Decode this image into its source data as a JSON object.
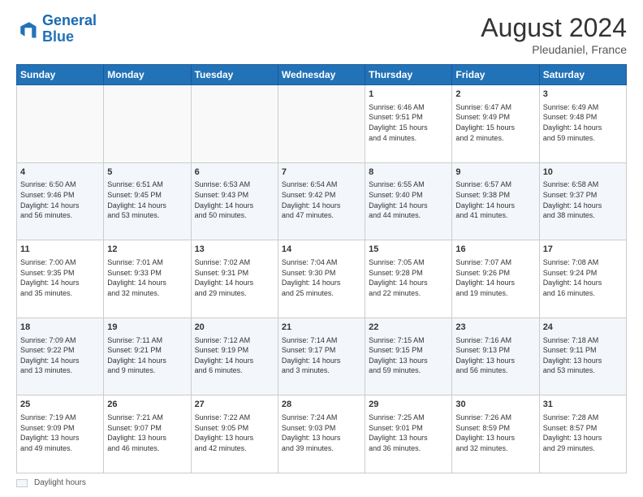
{
  "header": {
    "logo_general": "General",
    "logo_blue": "Blue",
    "month_year": "August 2024",
    "location": "Pleudaniel, France"
  },
  "footer": {
    "label": "Daylight hours"
  },
  "days_of_week": [
    "Sunday",
    "Monday",
    "Tuesday",
    "Wednesday",
    "Thursday",
    "Friday",
    "Saturday"
  ],
  "weeks": [
    {
      "days": [
        {
          "num": "",
          "info": ""
        },
        {
          "num": "",
          "info": ""
        },
        {
          "num": "",
          "info": ""
        },
        {
          "num": "",
          "info": ""
        },
        {
          "num": "1",
          "info": "Sunrise: 6:46 AM\nSunset: 9:51 PM\nDaylight: 15 hours\nand 4 minutes."
        },
        {
          "num": "2",
          "info": "Sunrise: 6:47 AM\nSunset: 9:49 PM\nDaylight: 15 hours\nand 2 minutes."
        },
        {
          "num": "3",
          "info": "Sunrise: 6:49 AM\nSunset: 9:48 PM\nDaylight: 14 hours\nand 59 minutes."
        }
      ]
    },
    {
      "days": [
        {
          "num": "4",
          "info": "Sunrise: 6:50 AM\nSunset: 9:46 PM\nDaylight: 14 hours\nand 56 minutes."
        },
        {
          "num": "5",
          "info": "Sunrise: 6:51 AM\nSunset: 9:45 PM\nDaylight: 14 hours\nand 53 minutes."
        },
        {
          "num": "6",
          "info": "Sunrise: 6:53 AM\nSunset: 9:43 PM\nDaylight: 14 hours\nand 50 minutes."
        },
        {
          "num": "7",
          "info": "Sunrise: 6:54 AM\nSunset: 9:42 PM\nDaylight: 14 hours\nand 47 minutes."
        },
        {
          "num": "8",
          "info": "Sunrise: 6:55 AM\nSunset: 9:40 PM\nDaylight: 14 hours\nand 44 minutes."
        },
        {
          "num": "9",
          "info": "Sunrise: 6:57 AM\nSunset: 9:38 PM\nDaylight: 14 hours\nand 41 minutes."
        },
        {
          "num": "10",
          "info": "Sunrise: 6:58 AM\nSunset: 9:37 PM\nDaylight: 14 hours\nand 38 minutes."
        }
      ]
    },
    {
      "days": [
        {
          "num": "11",
          "info": "Sunrise: 7:00 AM\nSunset: 9:35 PM\nDaylight: 14 hours\nand 35 minutes."
        },
        {
          "num": "12",
          "info": "Sunrise: 7:01 AM\nSunset: 9:33 PM\nDaylight: 14 hours\nand 32 minutes."
        },
        {
          "num": "13",
          "info": "Sunrise: 7:02 AM\nSunset: 9:31 PM\nDaylight: 14 hours\nand 29 minutes."
        },
        {
          "num": "14",
          "info": "Sunrise: 7:04 AM\nSunset: 9:30 PM\nDaylight: 14 hours\nand 25 minutes."
        },
        {
          "num": "15",
          "info": "Sunrise: 7:05 AM\nSunset: 9:28 PM\nDaylight: 14 hours\nand 22 minutes."
        },
        {
          "num": "16",
          "info": "Sunrise: 7:07 AM\nSunset: 9:26 PM\nDaylight: 14 hours\nand 19 minutes."
        },
        {
          "num": "17",
          "info": "Sunrise: 7:08 AM\nSunset: 9:24 PM\nDaylight: 14 hours\nand 16 minutes."
        }
      ]
    },
    {
      "days": [
        {
          "num": "18",
          "info": "Sunrise: 7:09 AM\nSunset: 9:22 PM\nDaylight: 14 hours\nand 13 minutes."
        },
        {
          "num": "19",
          "info": "Sunrise: 7:11 AM\nSunset: 9:21 PM\nDaylight: 14 hours\nand 9 minutes."
        },
        {
          "num": "20",
          "info": "Sunrise: 7:12 AM\nSunset: 9:19 PM\nDaylight: 14 hours\nand 6 minutes."
        },
        {
          "num": "21",
          "info": "Sunrise: 7:14 AM\nSunset: 9:17 PM\nDaylight: 14 hours\nand 3 minutes."
        },
        {
          "num": "22",
          "info": "Sunrise: 7:15 AM\nSunset: 9:15 PM\nDaylight: 13 hours\nand 59 minutes."
        },
        {
          "num": "23",
          "info": "Sunrise: 7:16 AM\nSunset: 9:13 PM\nDaylight: 13 hours\nand 56 minutes."
        },
        {
          "num": "24",
          "info": "Sunrise: 7:18 AM\nSunset: 9:11 PM\nDaylight: 13 hours\nand 53 minutes."
        }
      ]
    },
    {
      "days": [
        {
          "num": "25",
          "info": "Sunrise: 7:19 AM\nSunset: 9:09 PM\nDaylight: 13 hours\nand 49 minutes."
        },
        {
          "num": "26",
          "info": "Sunrise: 7:21 AM\nSunset: 9:07 PM\nDaylight: 13 hours\nand 46 minutes."
        },
        {
          "num": "27",
          "info": "Sunrise: 7:22 AM\nSunset: 9:05 PM\nDaylight: 13 hours\nand 42 minutes."
        },
        {
          "num": "28",
          "info": "Sunrise: 7:24 AM\nSunset: 9:03 PM\nDaylight: 13 hours\nand 39 minutes."
        },
        {
          "num": "29",
          "info": "Sunrise: 7:25 AM\nSunset: 9:01 PM\nDaylight: 13 hours\nand 36 minutes."
        },
        {
          "num": "30",
          "info": "Sunrise: 7:26 AM\nSunset: 8:59 PM\nDaylight: 13 hours\nand 32 minutes."
        },
        {
          "num": "31",
          "info": "Sunrise: 7:28 AM\nSunset: 8:57 PM\nDaylight: 13 hours\nand 29 minutes."
        }
      ]
    }
  ]
}
